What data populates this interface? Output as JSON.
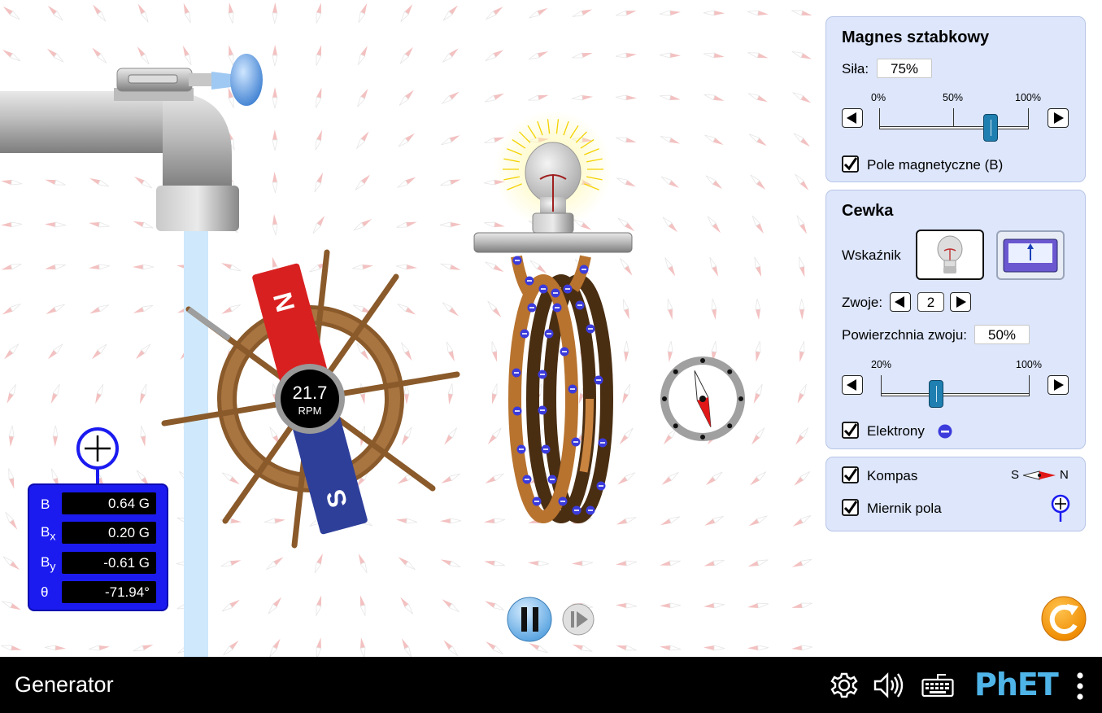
{
  "app": {
    "title": "Generator",
    "brand": "PhET"
  },
  "magnet": {
    "north_label": "N",
    "south_label": "S",
    "rpm_value": "21.7",
    "rpm_unit": "RPM"
  },
  "bar_magnet_panel": {
    "title": "Magnes sztabkowy",
    "strength_label": "Siła:",
    "strength_value": "75%",
    "strength_fraction": 0.75,
    "ticks": [
      "0%",
      "50%",
      "100%"
    ],
    "show_field_label": "Pole magnetyczne (B)",
    "show_field_checked": true
  },
  "coil_panel": {
    "title": "Cewka",
    "indicator_label": "Wskaźnik",
    "indicator_options": [
      "lightbulb",
      "voltmeter"
    ],
    "indicator_selected": "lightbulb",
    "loops_label": "Zwoje:",
    "loops_value": "2",
    "area_label": "Powierzchnia zwoju:",
    "area_value": "50%",
    "area_fraction": 0.5,
    "area_ticks": [
      "20%",
      "100%"
    ],
    "electrons_label": "Elektrony",
    "electrons_checked": true
  },
  "tools_panel": {
    "compass_label": "Kompas",
    "compass_checked": true,
    "compass_s": "S",
    "compass_n": "N",
    "field_meter_label": "Miernik pola",
    "field_meter_checked": true
  },
  "field_meter": {
    "rows": [
      {
        "label": "B",
        "sub": "",
        "value": "0.64 G"
      },
      {
        "label": "B",
        "sub": "x",
        "value": "0.20 G"
      },
      {
        "label": "B",
        "sub": "y",
        "value": "-0.61 G"
      },
      {
        "label": "θ",
        "sub": "",
        "value": "-71.94°"
      }
    ]
  },
  "colors": {
    "panel_bg": "#dde6fb",
    "meter_blue": "#1b1bf0",
    "north_red": "#d92020",
    "south_blue": "#2e3f9a",
    "copper": "#b8732f",
    "phet_blue": "#4fb4e8",
    "reset_orange": "#f39c12"
  },
  "icons": [
    "settings-gear-icon",
    "sound-icon",
    "keyboard-icon",
    "more-vertical-icon",
    "reset-icon",
    "pause-icon",
    "step-icon"
  ]
}
